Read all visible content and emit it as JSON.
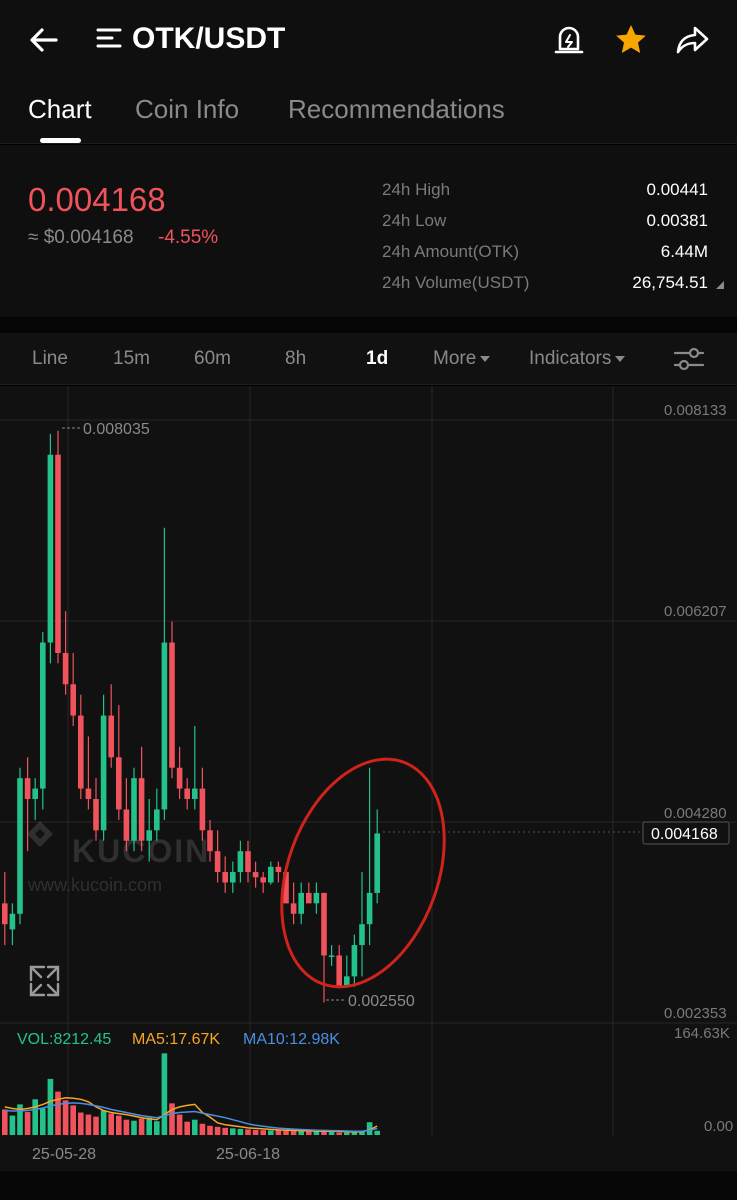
{
  "header": {
    "title": "OTK/USDT",
    "icons": [
      "back-arrow-icon",
      "menu-icon",
      "price-alert-icon",
      "star-icon",
      "share-icon"
    ],
    "favorite_color": "#f7a600"
  },
  "tabs": [
    {
      "label": "Chart",
      "active": true
    },
    {
      "label": "Coin Info",
      "active": false
    },
    {
      "label": "Recommendations",
      "active": false
    }
  ],
  "ticker": {
    "last_price": "0.004168",
    "approx_usd": "≈ $0.004168",
    "change_pct": "-4.55%",
    "down_color": "#f0535b",
    "up_color": "#23c28b"
  },
  "stats": [
    {
      "label": "24h High",
      "value": "0.00441"
    },
    {
      "label": "24h Low",
      "value": "0.00381"
    },
    {
      "label": "24h Amount(OTK)",
      "value": "6.44M"
    },
    {
      "label": "24h Volume(USDT)",
      "value": "26,754.51"
    }
  ],
  "intervals": [
    {
      "label": "Line",
      "active": false
    },
    {
      "label": "15m",
      "active": false
    },
    {
      "label": "60m",
      "active": false
    },
    {
      "label": "8h",
      "active": false
    },
    {
      "label": "1d",
      "active": true
    },
    {
      "label": "More",
      "active": false,
      "dropdown": true
    },
    {
      "label": "Indicators",
      "active": false,
      "dropdown": true
    }
  ],
  "chart": {
    "price_axis": [
      "0.008133",
      "0.006207",
      "0.004280",
      "0.002353"
    ],
    "current_price_tag": "0.004168",
    "high_marker": "0.008035",
    "low_marker": "0.002550",
    "watermark_brand": "KUCOIN",
    "watermark_url": "www.kucoin.com",
    "date_labels": [
      "25-05-28",
      "25-06-18"
    ],
    "annotation": "red-circle-around-recent-candles",
    "annotation_color": "#d0231b"
  },
  "volume": {
    "vol_label": "VOL:8212.45",
    "ma5_label": "MA5:17.67K",
    "ma10_label": "MA10:12.98K",
    "axis_max": "164.63K",
    "axis_min": "0.00",
    "ma5_color": "#f5a623",
    "ma10_color": "#4a90e2"
  },
  "chart_data": {
    "type": "candlestick",
    "interval": "1d",
    "ylim": [
      0.002353,
      0.008133
    ],
    "candles": [
      {
        "o": 0.0035,
        "h": 0.0038,
        "l": 0.0031,
        "c": 0.0033
      },
      {
        "o": 0.00325,
        "h": 0.0035,
        "l": 0.0031,
        "c": 0.0034
      },
      {
        "o": 0.0034,
        "h": 0.0048,
        "l": 0.0033,
        "c": 0.0047
      },
      {
        "o": 0.0047,
        "h": 0.0049,
        "l": 0.004,
        "c": 0.0045
      },
      {
        "o": 0.0045,
        "h": 0.0047,
        "l": 0.0043,
        "c": 0.0046
      },
      {
        "o": 0.0046,
        "h": 0.0061,
        "l": 0.0044,
        "c": 0.006
      },
      {
        "o": 0.006,
        "h": 0.008,
        "l": 0.0058,
        "c": 0.0078
      },
      {
        "o": 0.0078,
        "h": 0.00803,
        "l": 0.0058,
        "c": 0.0059
      },
      {
        "o": 0.0059,
        "h": 0.0063,
        "l": 0.0055,
        "c": 0.0056
      },
      {
        "o": 0.0056,
        "h": 0.0059,
        "l": 0.0052,
        "c": 0.0053
      },
      {
        "o": 0.0053,
        "h": 0.0055,
        "l": 0.0045,
        "c": 0.0046
      },
      {
        "o": 0.0046,
        "h": 0.0051,
        "l": 0.0044,
        "c": 0.0045
      },
      {
        "o": 0.0045,
        "h": 0.0047,
        "l": 0.0041,
        "c": 0.0042
      },
      {
        "o": 0.0042,
        "h": 0.0055,
        "l": 0.0041,
        "c": 0.0053
      },
      {
        "o": 0.0053,
        "h": 0.0056,
        "l": 0.0048,
        "c": 0.0049
      },
      {
        "o": 0.0049,
        "h": 0.0054,
        "l": 0.0043,
        "c": 0.0044
      },
      {
        "o": 0.0044,
        "h": 0.0047,
        "l": 0.004,
        "c": 0.0041
      },
      {
        "o": 0.0041,
        "h": 0.0048,
        "l": 0.004,
        "c": 0.0047
      },
      {
        "o": 0.0047,
        "h": 0.005,
        "l": 0.004,
        "c": 0.0041
      },
      {
        "o": 0.0041,
        "h": 0.0045,
        "l": 0.0039,
        "c": 0.0042
      },
      {
        "o": 0.0042,
        "h": 0.0046,
        "l": 0.0041,
        "c": 0.0044
      },
      {
        "o": 0.0044,
        "h": 0.0071,
        "l": 0.0043,
        "c": 0.006
      },
      {
        "o": 0.006,
        "h": 0.0062,
        "l": 0.0047,
        "c": 0.0048
      },
      {
        "o": 0.0048,
        "h": 0.005,
        "l": 0.0045,
        "c": 0.0046
      },
      {
        "o": 0.0046,
        "h": 0.0047,
        "l": 0.0044,
        "c": 0.0045
      },
      {
        "o": 0.0045,
        "h": 0.0052,
        "l": 0.0044,
        "c": 0.0046
      },
      {
        "o": 0.0046,
        "h": 0.0048,
        "l": 0.0041,
        "c": 0.0042
      },
      {
        "o": 0.0042,
        "h": 0.0043,
        "l": 0.0039,
        "c": 0.004
      },
      {
        "o": 0.004,
        "h": 0.0042,
        "l": 0.0037,
        "c": 0.0038
      },
      {
        "o": 0.0038,
        "h": 0.00395,
        "l": 0.0036,
        "c": 0.0037
      },
      {
        "o": 0.0037,
        "h": 0.0039,
        "l": 0.0036,
        "c": 0.0038
      },
      {
        "o": 0.0038,
        "h": 0.0041,
        "l": 0.0037,
        "c": 0.004
      },
      {
        "o": 0.004,
        "h": 0.0041,
        "l": 0.0037,
        "c": 0.0038
      },
      {
        "o": 0.0038,
        "h": 0.0039,
        "l": 0.00365,
        "c": 0.00375
      },
      {
        "o": 0.00375,
        "h": 0.0038,
        "l": 0.0036,
        "c": 0.0037
      },
      {
        "o": 0.0037,
        "h": 0.0039,
        "l": 0.00368,
        "c": 0.00385
      },
      {
        "o": 0.00385,
        "h": 0.0039,
        "l": 0.0037,
        "c": 0.0038
      },
      {
        "o": 0.0038,
        "h": 0.0038,
        "l": 0.0035,
        "c": 0.0035
      },
      {
        "o": 0.0035,
        "h": 0.0037,
        "l": 0.0033,
        "c": 0.0034
      },
      {
        "o": 0.0034,
        "h": 0.0037,
        "l": 0.0033,
        "c": 0.0036
      },
      {
        "o": 0.0036,
        "h": 0.0037,
        "l": 0.0035,
        "c": 0.0035
      },
      {
        "o": 0.0035,
        "h": 0.0037,
        "l": 0.0034,
        "c": 0.0036
      },
      {
        "o": 0.0036,
        "h": 0.0036,
        "l": 0.00255,
        "c": 0.003
      },
      {
        "o": 0.003,
        "h": 0.0031,
        "l": 0.0029,
        "c": 0.003
      },
      {
        "o": 0.003,
        "h": 0.0031,
        "l": 0.0027,
        "c": 0.0027
      },
      {
        "o": 0.0027,
        "h": 0.003,
        "l": 0.0027,
        "c": 0.0028
      },
      {
        "o": 0.0028,
        "h": 0.0032,
        "l": 0.0027,
        "c": 0.0031
      },
      {
        "o": 0.0031,
        "h": 0.0038,
        "l": 0.0028,
        "c": 0.0033
      },
      {
        "o": 0.0033,
        "h": 0.0048,
        "l": 0.0031,
        "c": 0.0036
      },
      {
        "o": 0.0036,
        "h": 0.0044,
        "l": 0.0035,
        "c": 0.00417
      }
    ],
    "volume_max": 164630,
    "volumes": [
      50000,
      38000,
      60000,
      45000,
      70000,
      52000,
      110000,
      85000,
      68000,
      58000,
      44000,
      40000,
      36000,
      48000,
      42000,
      38000,
      30000,
      28000,
      32000,
      34000,
      27000,
      160000,
      62000,
      40000,
      26000,
      30000,
      22000,
      18000,
      16000,
      14000,
      13000,
      12000,
      11000,
      10000,
      9500,
      9000,
      9000,
      8500,
      8000,
      7500,
      7200,
      7000,
      9000,
      6000,
      5000,
      4800,
      5200,
      6000,
      25000,
      8212
    ],
    "ma5": [
      55000,
      52000,
      50000,
      52000,
      55000,
      60000,
      66000,
      70000,
      73000,
      72000,
      70000,
      65000,
      55000,
      48000,
      44000,
      42000,
      40000,
      37000,
      34000,
      32000,
      30000,
      40000,
      50000,
      55000,
      58000,
      60000,
      44000,
      35000,
      24000,
      20000,
      18000,
      16000,
      14000,
      13000,
      12000,
      11000,
      10000,
      9500,
      9000,
      8500,
      8000,
      7600,
      7500,
      7400,
      7000,
      6500,
      6000,
      6200,
      10000,
      17670
    ],
    "ma10": [
      48000,
      47000,
      47000,
      48000,
      50000,
      53000,
      57000,
      60000,
      62000,
      63000,
      62000,
      60000,
      57000,
      54000,
      50000,
      47000,
      44000,
      41000,
      38000,
      36000,
      34000,
      38000,
      42000,
      44000,
      45000,
      46000,
      43000,
      40000,
      37000,
      34000,
      30000,
      26000,
      22000,
      19000,
      17000,
      15000,
      13500,
      12500,
      11500,
      10800,
      10000,
      9500,
      9000,
      8600,
      8200,
      7800,
      7400,
      7200,
      9000,
      12980
    ]
  }
}
